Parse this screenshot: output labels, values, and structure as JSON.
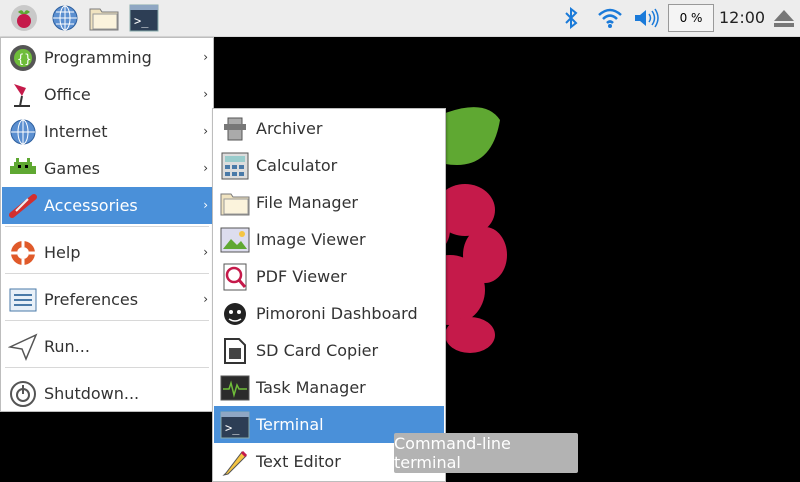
{
  "taskbar": {
    "icons": [
      "raspberry-menu-icon",
      "web-browser-icon",
      "file-manager-icon",
      "terminal-icon"
    ],
    "tray": [
      "bluetooth-icon",
      "wifi-icon",
      "volume-icon"
    ],
    "cpu_label": "0 %",
    "cpu_level": 0,
    "clock": "12:00",
    "eject_icon": "eject-icon"
  },
  "main_menu": {
    "items": [
      {
        "label": "Programming",
        "icon": "programming-icon",
        "has_submenu": true
      },
      {
        "label": "Office",
        "icon": "office-icon",
        "has_submenu": true
      },
      {
        "label": "Internet",
        "icon": "internet-icon",
        "has_submenu": true
      },
      {
        "label": "Games",
        "icon": "games-icon",
        "has_submenu": true
      },
      {
        "label": "Accessories",
        "icon": "accessories-icon",
        "has_submenu": true,
        "selected": true
      },
      {
        "label": "Help",
        "icon": "help-icon",
        "has_submenu": true
      },
      {
        "label": "Preferences",
        "icon": "preferences-icon",
        "has_submenu": true
      },
      {
        "label": "Run...",
        "icon": "run-icon"
      },
      {
        "label": "Shutdown...",
        "icon": "shutdown-icon"
      }
    ],
    "arrow": "›"
  },
  "sub_menu": {
    "items": [
      {
        "label": "Archiver",
        "icon": "archiver-icon"
      },
      {
        "label": "Calculator",
        "icon": "calculator-icon"
      },
      {
        "label": "File Manager",
        "icon": "file-manager-icon"
      },
      {
        "label": "Image Viewer",
        "icon": "image-viewer-icon"
      },
      {
        "label": "PDF Viewer",
        "icon": "pdf-viewer-icon"
      },
      {
        "label": "Pimoroni Dashboard",
        "icon": "pimoroni-icon"
      },
      {
        "label": "SD Card Copier",
        "icon": "sd-card-icon"
      },
      {
        "label": "Task Manager",
        "icon": "task-manager-icon"
      },
      {
        "label": "Terminal",
        "icon": "terminal-icon",
        "selected": true
      },
      {
        "label": "Text Editor",
        "icon": "text-editor-icon"
      }
    ]
  },
  "tooltip": "Command-line terminal",
  "colors": {
    "selection": "#4a90d9",
    "accent": "#1a7ad9"
  }
}
